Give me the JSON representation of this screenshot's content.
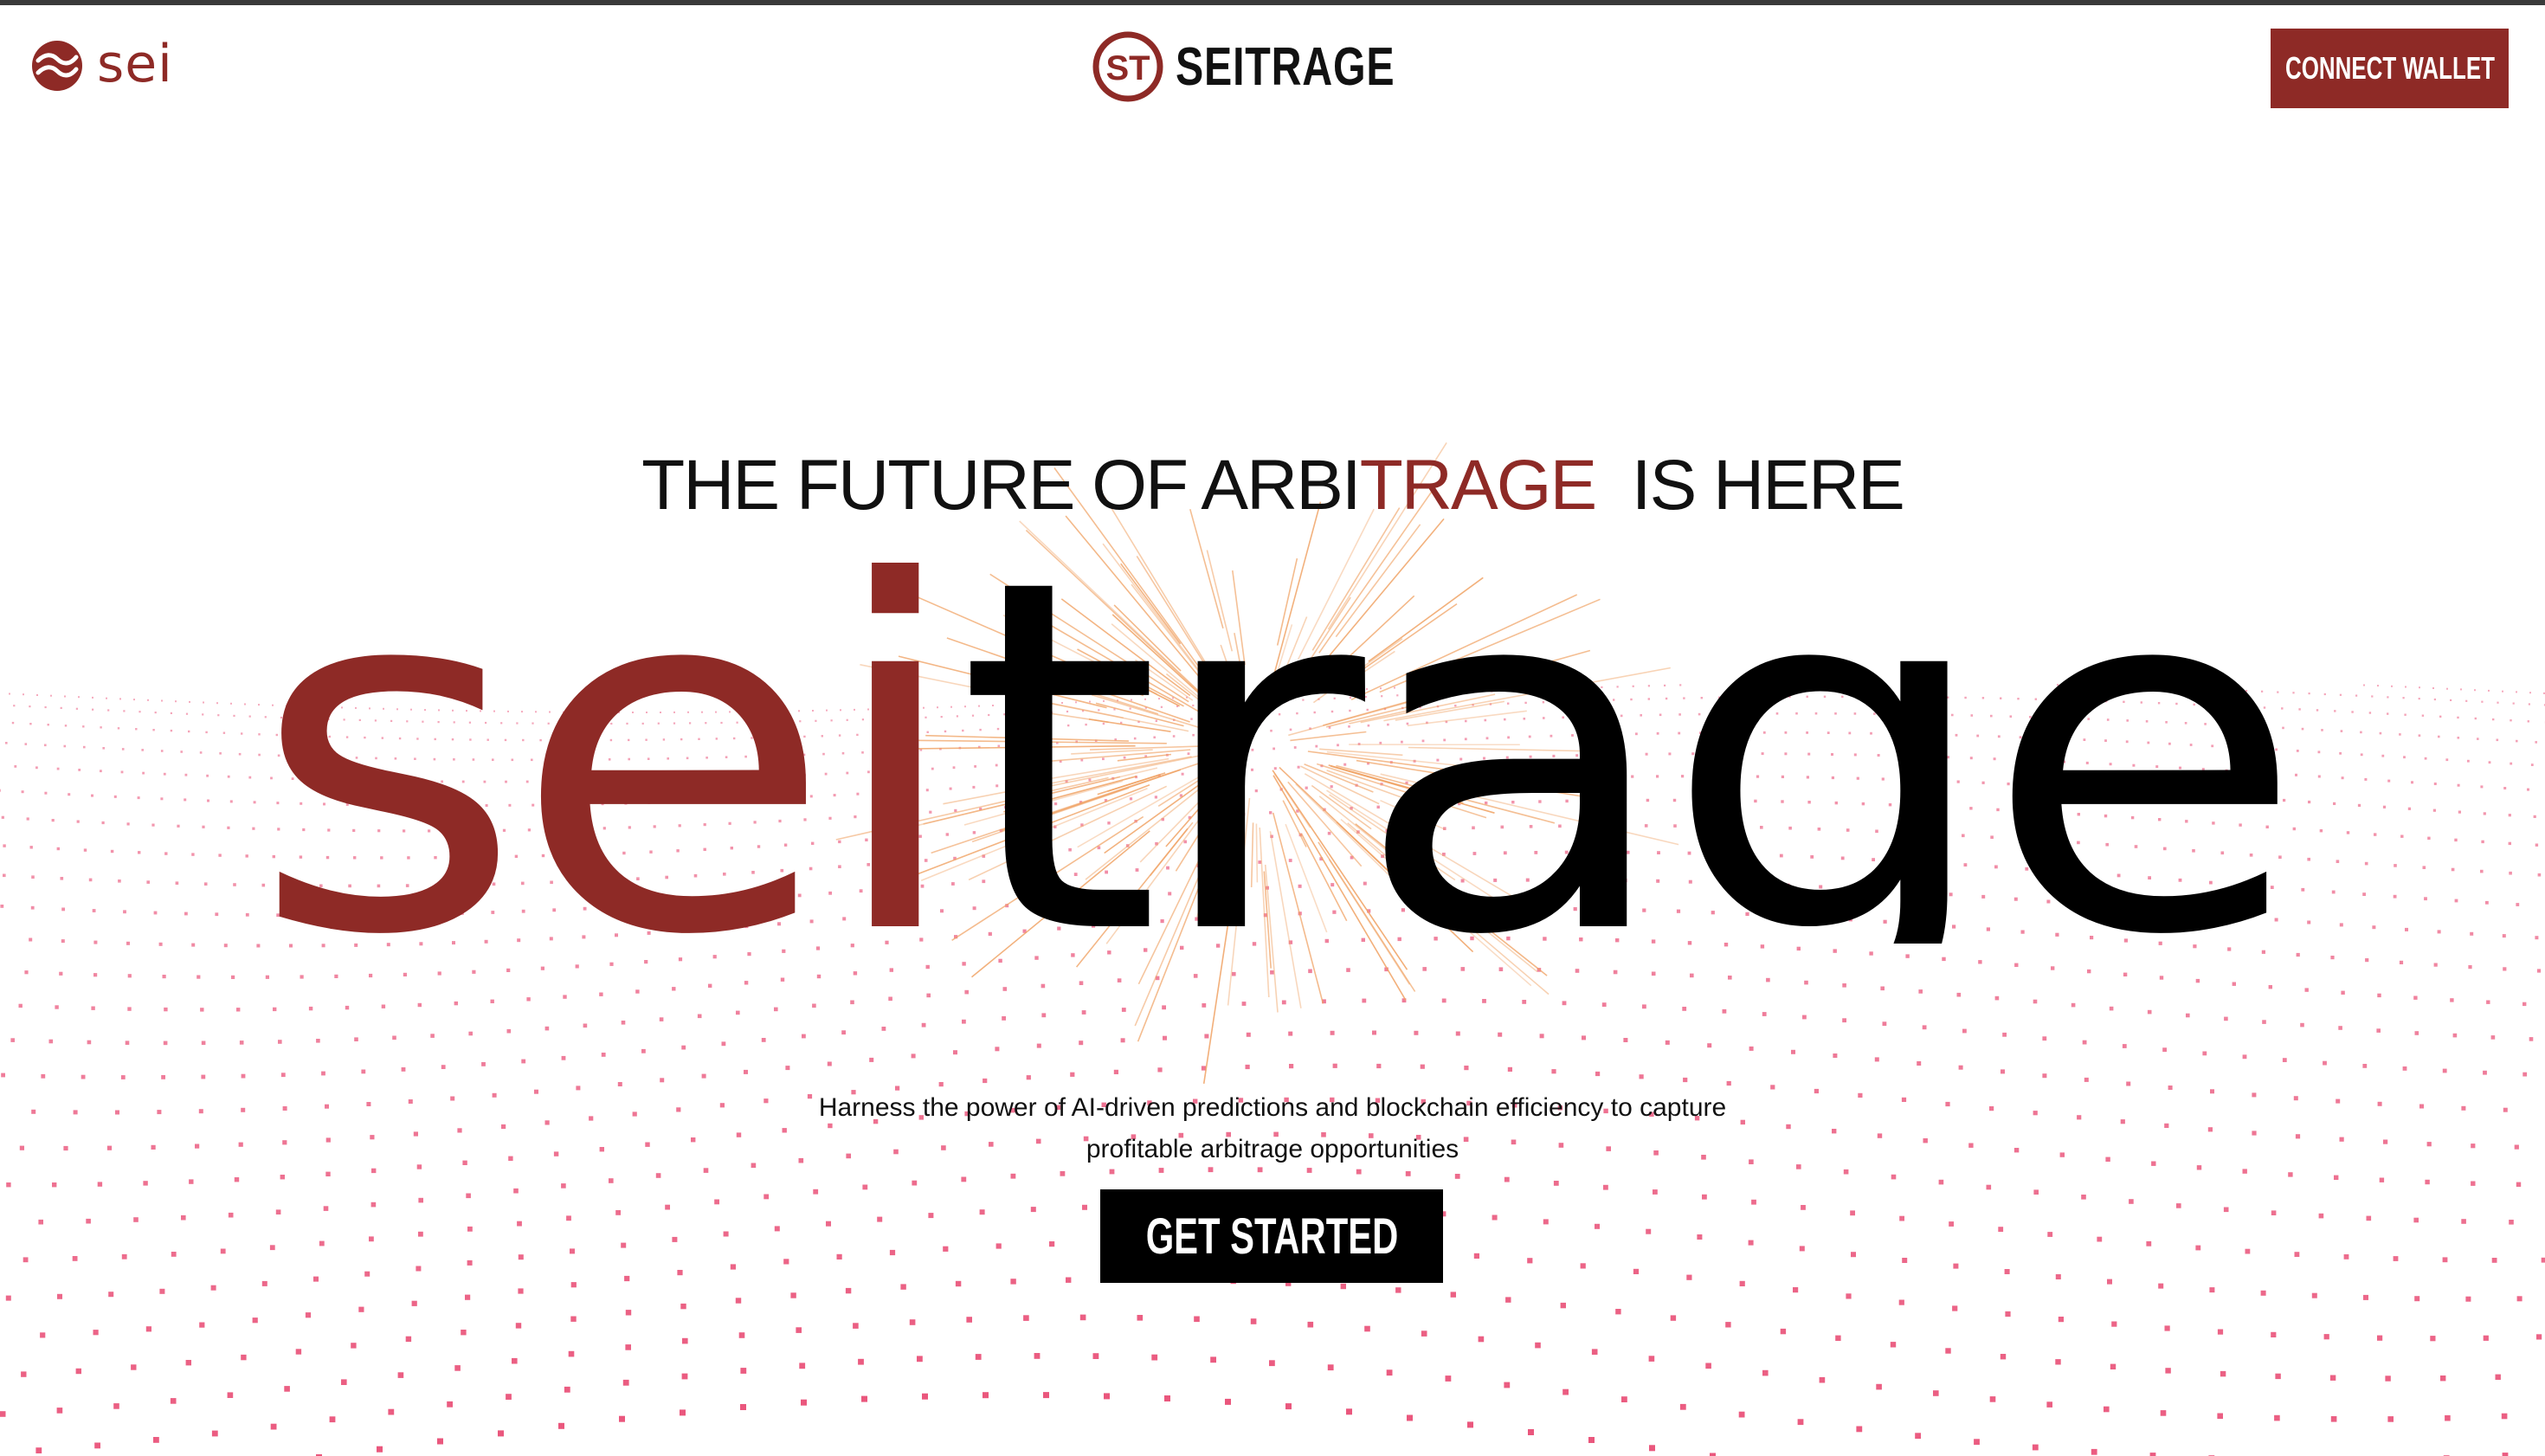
{
  "header": {
    "partner_logo_text": "sei",
    "brand_name": "SEITRAGE",
    "brand_badge_text": "ST",
    "connect_label": "CONNECT WALLET"
  },
  "hero": {
    "tagline_prefix": "THE FUTURE OF ARBI",
    "tagline_highlight": "TRAGE",
    "tagline_suffix": " IS HERE",
    "word_part1": "sei",
    "word_part2": "trage",
    "subtitle_line1": "Harness the power of AI-driven predictions and blockchain efficiency to capture",
    "subtitle_line2": "profitable arbitrage opportunities",
    "cta_label": "GET STARTED"
  },
  "colors": {
    "brand_red": "#8e2a26",
    "black": "#000000",
    "particle_pink": "#e8456f",
    "burst_orange": "#f0a060"
  },
  "icons": {
    "partner_logo": "sei-wave-icon",
    "brand_badge": "st-badge-icon"
  }
}
